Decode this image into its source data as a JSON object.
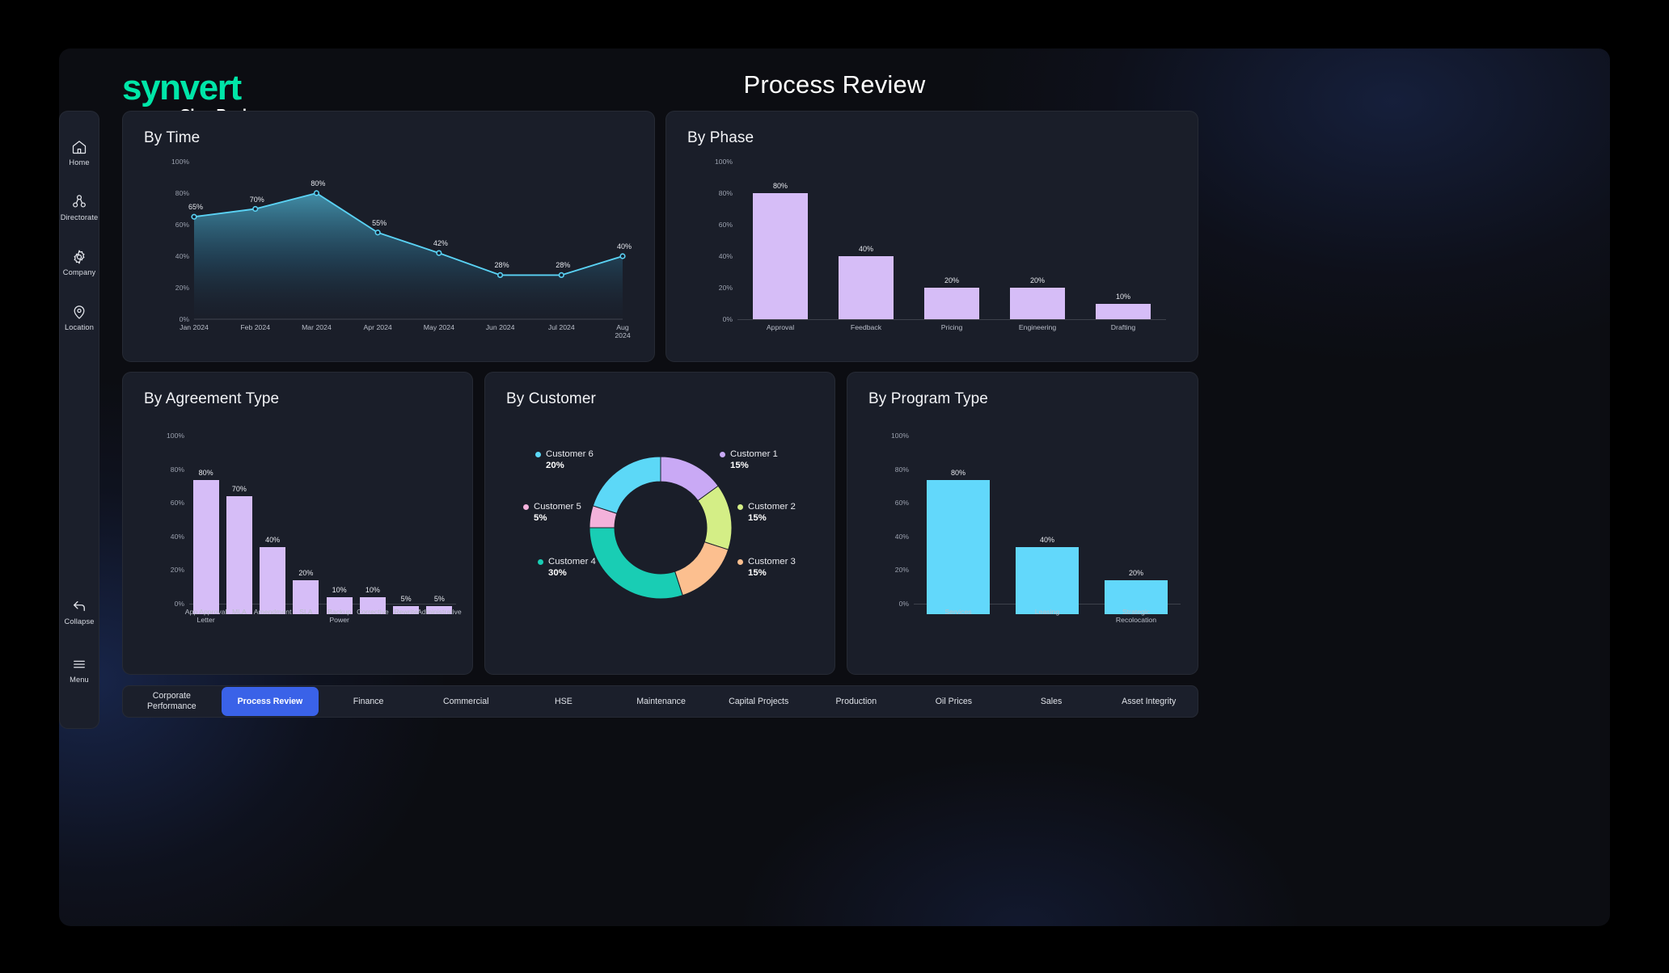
{
  "brand": {
    "name": "synvert",
    "sub": "ClearPeaks"
  },
  "header": {
    "title": "Process Review"
  },
  "sidebar": {
    "top_items": [
      {
        "label": "Home",
        "icon": "home-icon"
      },
      {
        "label": "Directorate",
        "icon": "org-chart-icon"
      },
      {
        "label": "Company",
        "icon": "gear-icon"
      },
      {
        "label": "Location",
        "icon": "map-pin-icon"
      }
    ],
    "bottom_items": [
      {
        "label": "Collapse",
        "icon": "arrow-left-icon"
      },
      {
        "label": "Menu",
        "icon": "hamburger-icon"
      }
    ]
  },
  "cards": {
    "time": {
      "title": "By Time"
    },
    "phase": {
      "title": "By Phase"
    },
    "agreement": {
      "title": "By Agreement Type"
    },
    "customer": {
      "title": "By Customer"
    },
    "program": {
      "title": "By Program Type"
    }
  },
  "tabs": [
    {
      "label": "Corporate\nPerformance",
      "active": false
    },
    {
      "label": "Process Review",
      "active": true
    },
    {
      "label": "Finance",
      "active": false
    },
    {
      "label": "Commercial",
      "active": false
    },
    {
      "label": "HSE",
      "active": false
    },
    {
      "label": "Maintenance",
      "active": false
    },
    {
      "label": "Capital Projects",
      "active": false
    },
    {
      "label": "Production",
      "active": false
    },
    {
      "label": "Oil Prices",
      "active": false
    },
    {
      "label": "Sales",
      "active": false
    },
    {
      "label": "Asset Integrity",
      "active": false
    }
  ],
  "colors": {
    "accent_teal": "#00e6a8",
    "line_cyan": "#5ad2f4",
    "bar_lavender": "#d6bdf7",
    "bar_cyan": "#62d8fb",
    "tab_active_blue": "#3a62e8",
    "card_bg": "#1a1e29",
    "app_bg": "#0c0d12"
  },
  "chart_data": [
    {
      "type": "line",
      "title": "By Time",
      "categories": [
        "Jan 2024",
        "Feb 2024",
        "Mar 2024",
        "Apr 2024",
        "May 2024",
        "Jun 2024",
        "Jul 2024",
        "Aug 2024"
      ],
      "values": [
        65,
        70,
        80,
        55,
        42,
        28,
        28,
        40
      ],
      "value_labels": [
        "65%",
        "70%",
        "80%",
        "55%",
        "42%",
        "28%",
        "28%",
        "40%"
      ],
      "yticks": [
        0,
        20,
        40,
        60,
        80,
        100
      ],
      "ytick_labels": [
        "0%",
        "20%",
        "40%",
        "60%",
        "80%",
        "100%"
      ],
      "ylim": [
        0,
        100
      ],
      "xlabel": "",
      "ylabel": "",
      "grid": false,
      "legend": "none",
      "series_color": "#5ad2f4",
      "area_fill": true
    },
    {
      "type": "bar",
      "title": "By Phase",
      "categories": [
        "Approval",
        "Feedback",
        "Pricing",
        "Engineering",
        "Drafting"
      ],
      "values": [
        80,
        40,
        20,
        20,
        10
      ],
      "value_labels": [
        "80%",
        "40%",
        "20%",
        "20%",
        "10%"
      ],
      "yticks": [
        0,
        20,
        40,
        60,
        80,
        100
      ],
      "ytick_labels": [
        "0%",
        "20%",
        "40%",
        "60%",
        "80%",
        "100%"
      ],
      "ylim": [
        0,
        100
      ],
      "xlabel": "",
      "ylabel": "",
      "grid": false,
      "legend": "none",
      "bar_color": "#d6bdf7"
    },
    {
      "type": "bar",
      "title": "By Agreement Type",
      "categories": [
        "App Approval\nLetter",
        "MLA",
        "Amendment",
        "SLA",
        "Backup\nPower",
        "Corrective",
        "Rewrite",
        "Administrative"
      ],
      "values": [
        80,
        70,
        40,
        20,
        10,
        10,
        5,
        5
      ],
      "value_labels": [
        "80%",
        "70%",
        "40%",
        "20%",
        "10%",
        "10%",
        "5%",
        "5%"
      ],
      "yticks": [
        0,
        20,
        40,
        60,
        80,
        100
      ],
      "ytick_labels": [
        "0%",
        "20%",
        "40%",
        "60%",
        "80%",
        "100%"
      ],
      "ylim": [
        0,
        100
      ],
      "xlabel": "",
      "ylabel": "",
      "grid": false,
      "legend": "none",
      "bar_color": "#d6bdf7"
    },
    {
      "type": "pie",
      "title": "By Customer",
      "donut": true,
      "labels": [
        "Customer 1",
        "Customer 2",
        "Customer 3",
        "Customer 4",
        "Customer 5",
        "Customer 6"
      ],
      "values": [
        15,
        15,
        15,
        30,
        5,
        20
      ],
      "value_labels": [
        "15%",
        "15%",
        "15%",
        "30%",
        "5%",
        "20%"
      ],
      "colors": [
        "#c9a9f5",
        "#d4ee86",
        "#fcbf8f",
        "#19cdb4",
        "#f3b2db",
        "#5cd8f7"
      ],
      "legend": "sides"
    },
    {
      "type": "bar",
      "title": "By Program Type",
      "categories": [
        "Services",
        "Leasing",
        "Strategic\nRecolocation"
      ],
      "values": [
        80,
        40,
        20
      ],
      "value_labels": [
        "80%",
        "40%",
        "20%"
      ],
      "yticks": [
        0,
        20,
        40,
        60,
        80,
        100
      ],
      "ytick_labels": [
        "0%",
        "20%",
        "40%",
        "60%",
        "80%",
        "100%"
      ],
      "ylim": [
        0,
        100
      ],
      "xlabel": "",
      "ylabel": "",
      "grid": false,
      "legend": "none",
      "bar_color": "#62d8fb"
    }
  ]
}
